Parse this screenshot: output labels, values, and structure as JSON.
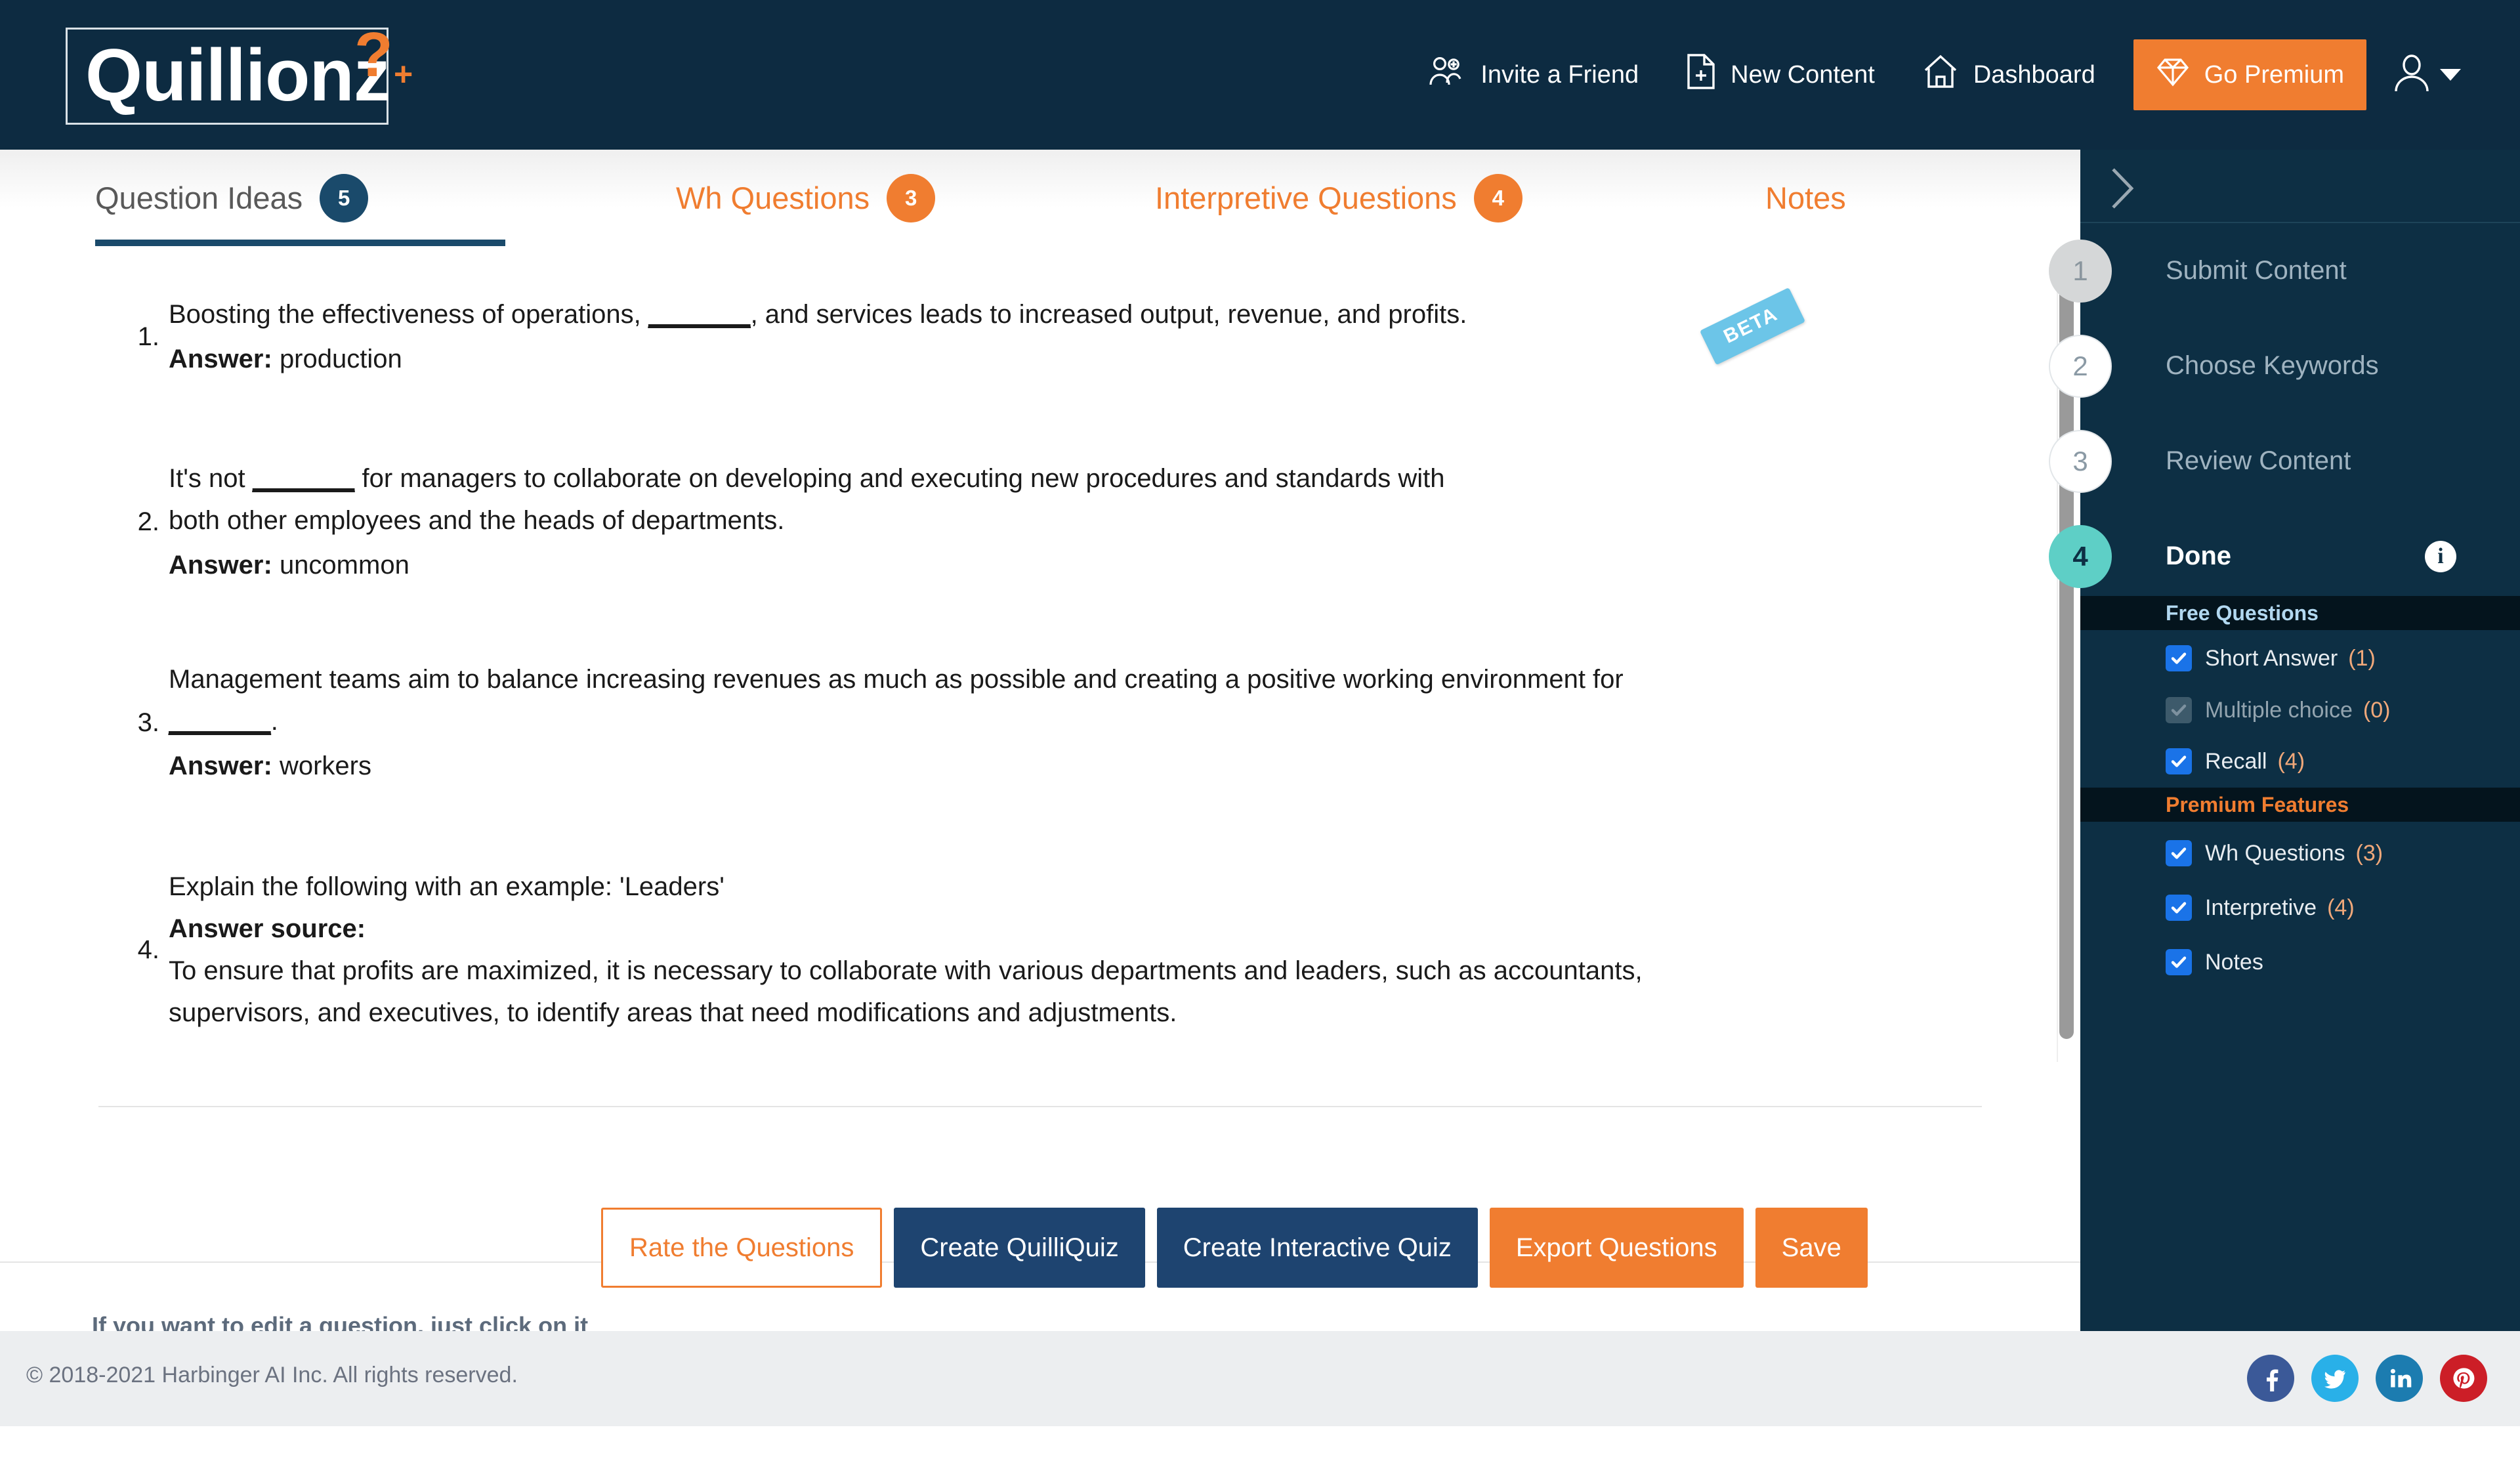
{
  "header": {
    "logo": {
      "text": "Quillionz",
      "question_mark": "?",
      "plus": "+"
    },
    "nav": [
      {
        "label": "Invite a Friend",
        "icon": "add-user-icon"
      },
      {
        "label": "New Content",
        "icon": "document-plus-icon"
      },
      {
        "label": "Dashboard",
        "icon": "home-icon"
      }
    ],
    "go_premium": {
      "label": "Go Premium",
      "icon": "diamond-icon",
      "color": "#f07d30"
    },
    "account": {
      "icon": "user-avatar-icon",
      "caret": "chevron-down-icon"
    }
  },
  "tabs": [
    {
      "label": "Question Ideas",
      "count": "5",
      "active": true
    },
    {
      "label": "Wh Questions",
      "count": "3",
      "active": false
    },
    {
      "label": "Interpretive Questions",
      "count": "4",
      "active": false
    },
    {
      "label": "Notes",
      "count": "",
      "active": false,
      "ribbon": "BETA"
    }
  ],
  "questions": [
    {
      "number": "1.",
      "text_parts": [
        "Boosting the effectiveness of operations, ",
        "_______",
        ", and services leads to increased output, revenue, and profits."
      ],
      "answer_label": "Answer:",
      "answer_value": "production"
    },
    {
      "number": "2.",
      "text_parts": [
        "It's not ",
        "_______",
        " for managers to collaborate on developing and executing new procedures and standards with both other employees and the heads of departments."
      ],
      "answer_label": "Answer:",
      "answer_value": "uncommon"
    },
    {
      "number": "3.",
      "text_parts": [
        "Management teams aim to balance increasing revenues as much as possible and creating a positive working environment for ",
        "_______",
        "."
      ],
      "answer_label": "Answer:",
      "answer_value": "workers"
    },
    {
      "number": "4.",
      "text_parts": [
        "Explain the following with an example: 'Leaders'",
        "",
        ""
      ],
      "answer_label": "Answer source:",
      "answer_value": "To ensure that profits are maximized, it is necessary to collaborate with various departments and leaders, such as accountants, supervisors, and executives, to identify areas that need modifications and adjustments."
    }
  ],
  "action_bar": {
    "hint": "If you want to edit a question, just click on it",
    "buttons": [
      {
        "label": "Rate the Questions",
        "style": "outline-orange"
      },
      {
        "label": "Create QuilliQuiz",
        "style": "navy"
      },
      {
        "label": "Create Interactive Quiz",
        "style": "navy"
      },
      {
        "label": "Export Questions",
        "style": "orange"
      },
      {
        "label": "Save",
        "style": "orange"
      }
    ]
  },
  "sidebar": {
    "collapse_icon": "chevron-right-icon",
    "steps": [
      {
        "num": "1",
        "label": "Submit Content",
        "state": "done"
      },
      {
        "num": "2",
        "label": "Choose Keywords",
        "state": "pending"
      },
      {
        "num": "3",
        "label": "Review Content",
        "state": "pending"
      },
      {
        "num": "4",
        "label": "Done",
        "state": "current",
        "info_icon": "info-icon"
      }
    ],
    "sections": [
      {
        "title": "Free Questions",
        "color": "#b2d8f0",
        "items": [
          {
            "label": "Short Answer",
            "count": "(1)",
            "checked": true,
            "disabled": false
          },
          {
            "label": "Multiple choice",
            "count": "(0)",
            "checked": true,
            "disabled": true
          },
          {
            "label": "Recall",
            "count": "(4)",
            "checked": true,
            "disabled": false
          }
        ]
      },
      {
        "title": "Premium Features",
        "color": "#f07d30",
        "items": [
          {
            "label": "Wh Questions",
            "count": "(3)",
            "checked": true,
            "disabled": false
          },
          {
            "label": "Interpretive",
            "count": "(4)",
            "checked": true,
            "disabled": false
          },
          {
            "label": "Notes",
            "count": "",
            "checked": true,
            "disabled": false
          }
        ]
      }
    ]
  },
  "footer": {
    "copyright": "© 2018-2021 Harbinger AI Inc. All rights reserved.",
    "social": [
      {
        "name": "facebook-icon",
        "color": "#3b5998"
      },
      {
        "name": "twitter-icon",
        "color": "#29b0e8"
      },
      {
        "name": "linkedin-icon",
        "color": "#1c7cb0"
      },
      {
        "name": "pinterest-icon",
        "color": "#cc1e27"
      }
    ]
  }
}
